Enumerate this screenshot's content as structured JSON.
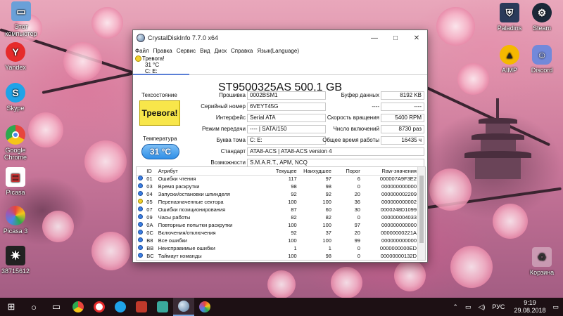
{
  "desktop": {
    "icons_left": [
      {
        "name": "recycle-bin",
        "label": "Этот компьютер"
      },
      {
        "name": "yandex",
        "label": "Yandex"
      },
      {
        "name": "skype",
        "label": "Skype"
      },
      {
        "name": "chrome",
        "label": "Google Chrome"
      },
      {
        "name": "picasa-old",
        "label": "Picasa"
      },
      {
        "name": "picasa",
        "label": "Picasa 3"
      },
      {
        "name": "user-file",
        "label": "38715612"
      }
    ],
    "icons_right": [
      {
        "name": "paladins",
        "label": "Paladins"
      },
      {
        "name": "steam",
        "label": "Steam"
      },
      {
        "name": "aimp",
        "label": "AIMP"
      },
      {
        "name": "discord",
        "label": "Discord"
      },
      {
        "name": "recycle",
        "label": "Корзина"
      }
    ]
  },
  "window": {
    "title": "CrystalDiskInfo 7.7.0 x64",
    "controls": {
      "minimize": "—",
      "maximize": "□",
      "close": "✕"
    },
    "menu": [
      "Файл",
      "Правка",
      "Сервис",
      "Вид",
      "Диск",
      "Справка",
      "Язык(Language)"
    ],
    "disk_tab": {
      "status": "Тревога!",
      "temp": "31 °C",
      "letter": "C: E:"
    },
    "model": "ST9500325AS 500,1 GB",
    "health_label": "Техсостояние",
    "health_value": "Тревога!",
    "temp_label": "Температура",
    "temp_value": "31 °C",
    "fields": {
      "firmware_label": "Прошивка",
      "firmware": "0002BSM1",
      "serial_label": "Серийный номер",
      "serial": "6VEYT45G",
      "interface_label": "Интерфейс",
      "interface": "Serial ATA",
      "transfer_label": "Режим передачи",
      "transfer": "---- | SATA/150",
      "drive_label": "Буква тома",
      "drive": "C: E:",
      "standard_label": "Стандарт",
      "standard": "ATA8-ACS | ATA8-ACS version 4",
      "features_label": "Возможности",
      "features": "S.M.A.R.T., APM, NCQ",
      "buffer_label": "Буфер данных",
      "buffer": "8192 KB",
      "blank1_label": "----",
      "blank1": "----",
      "rpm_label": "Скорость вращения",
      "rpm": "5400 RPM",
      "power_count_label": "Число включений",
      "power_count": "8730 раз",
      "power_hours_label": "Общее время работы",
      "power_hours": "16435 ч"
    },
    "smart_headers": [
      "ID",
      "Атрибут",
      "Текущее",
      "Наихудшее",
      "Порог",
      "Raw-значения"
    ],
    "smart_rows": [
      {
        "status": "b",
        "id": "01",
        "name": "Ошибки чтения",
        "cur": "117",
        "worst": "97",
        "thr": "6",
        "raw": "000007A9F3E2"
      },
      {
        "status": "b",
        "id": "03",
        "name": "Время раскрутки",
        "cur": "98",
        "worst": "98",
        "thr": "0",
        "raw": "000000000000"
      },
      {
        "status": "b",
        "id": "04",
        "name": "Запуски/остановки шпинделя",
        "cur": "92",
        "worst": "92",
        "thr": "20",
        "raw": "000000002209"
      },
      {
        "status": "y",
        "id": "05",
        "name": "Переназначенные сектора",
        "cur": "100",
        "worst": "100",
        "thr": "36",
        "raw": "000000000002"
      },
      {
        "status": "b",
        "id": "07",
        "name": "Ошибки позиционирования",
        "cur": "87",
        "worst": "60",
        "thr": "30",
        "raw": "0000248D1099"
      },
      {
        "status": "b",
        "id": "09",
        "name": "Часы работы",
        "cur": "82",
        "worst": "82",
        "thr": "0",
        "raw": "000000004033"
      },
      {
        "status": "b",
        "id": "0A",
        "name": "Повторные попытки раскрутки",
        "cur": "100",
        "worst": "100",
        "thr": "97",
        "raw": "000000000000"
      },
      {
        "status": "b",
        "id": "0C",
        "name": "Включения/отключения",
        "cur": "92",
        "worst": "37",
        "thr": "20",
        "raw": "00000000221A"
      },
      {
        "status": "b",
        "id": "B8",
        "name": "Все ошибки",
        "cur": "100",
        "worst": "100",
        "thr": "99",
        "raw": "000000000000"
      },
      {
        "status": "b",
        "id": "BB",
        "name": "Неисправимые ошибки",
        "cur": "1",
        "worst": "1",
        "thr": "0",
        "raw": "0000000000ED"
      },
      {
        "status": "b",
        "id": "BC",
        "name": "Таймаут команды",
        "cur": "100",
        "worst": "98",
        "thr": "0",
        "raw": "00000000132D"
      }
    ]
  },
  "taskbar": {
    "start": "⊞",
    "search": "○",
    "taskview": "▭",
    "lang": "РУС",
    "time": "9:19",
    "date": "29.08.2018"
  },
  "colors": {
    "warning": "#f8e64a",
    "temp_blue": "#2f8fe7",
    "ok_blue": "#3b7ee3"
  }
}
